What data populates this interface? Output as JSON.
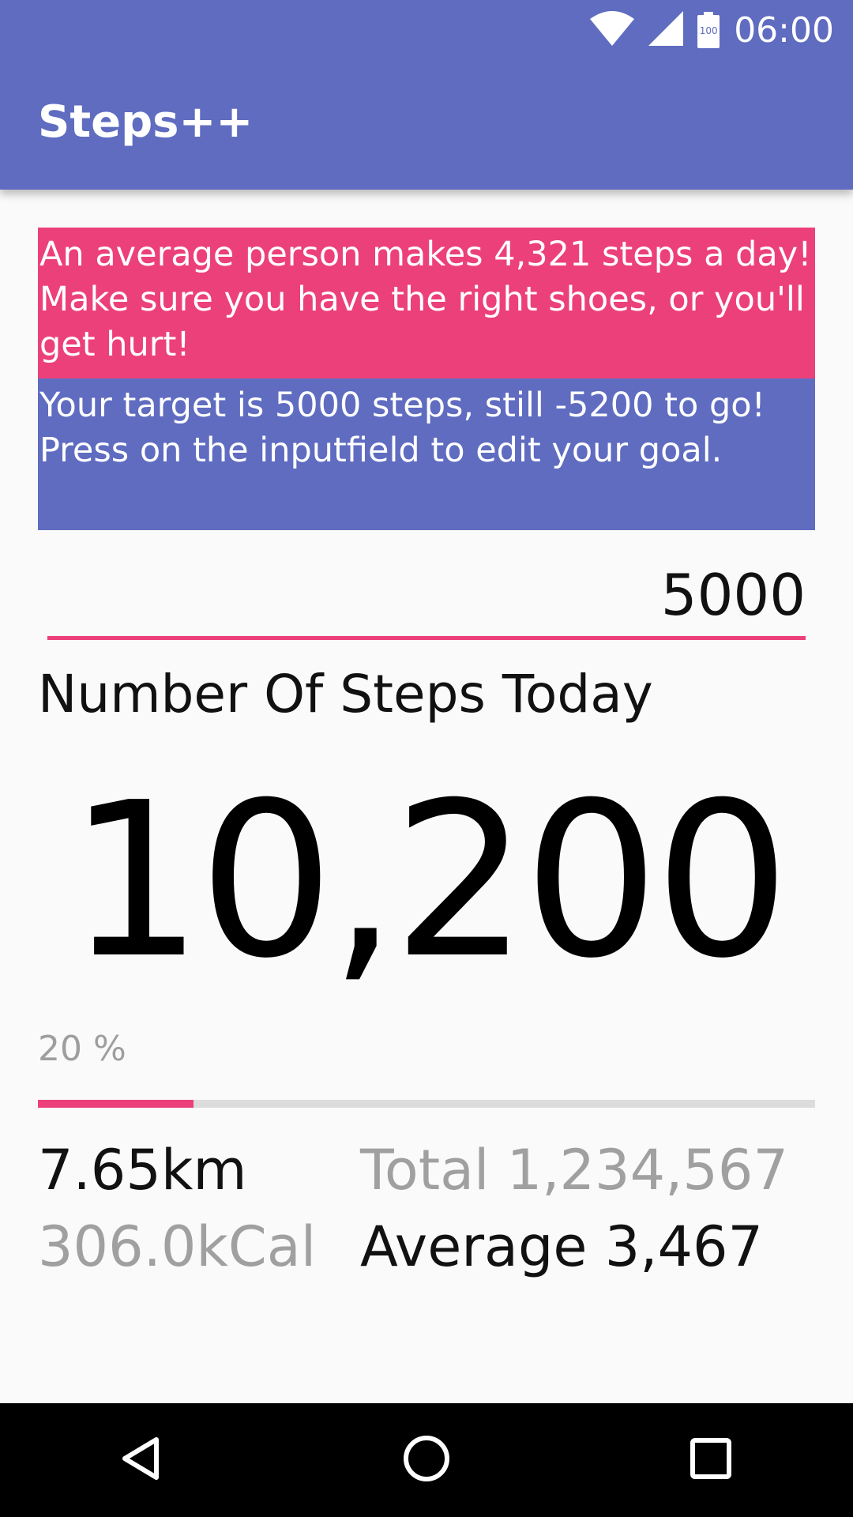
{
  "status_bar": {
    "time": "06:00",
    "battery_level": "100",
    "icons": [
      "wifi-icon",
      "cellular-signal-icon",
      "battery-icon"
    ]
  },
  "app_bar": {
    "title": "Steps++"
  },
  "tip": {
    "text": "An average person makes 4,321 steps a day! Make sure you have the right shoes, or you'll get hurt!"
  },
  "target": {
    "text": "Your target is 5000 steps, still -5200 to go! Press on the inputfield to edit your goal."
  },
  "goal_input": {
    "value": "5000"
  },
  "steps": {
    "heading": "Number Of Steps Today",
    "count": "10,200"
  },
  "progress": {
    "label": "20 %",
    "percent": 20
  },
  "stats": {
    "distance": "7.65km",
    "calories": "306.0kCal",
    "total": "Total 1,234,567",
    "average": "Average 3,467"
  },
  "nav_bar": {
    "buttons": [
      "back-icon",
      "home-icon",
      "recents-icon"
    ]
  },
  "colors": {
    "primary": "#5f6cc0",
    "accent": "#ec407a",
    "background": "#fafafa"
  }
}
